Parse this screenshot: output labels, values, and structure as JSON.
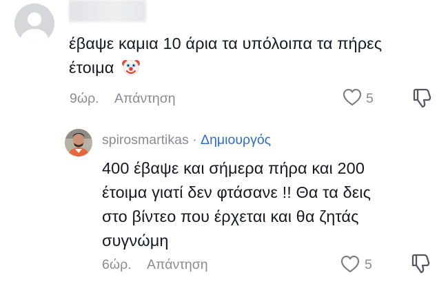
{
  "comment1": {
    "text_line1": "έβαψε καμια 10 άρια τα υπόλοιπα τα πήρες",
    "text_line2": "έτοιμα",
    "emoji": "clown-face-emoji",
    "time": "9ώρ.",
    "reply_label": "Απάντηση",
    "likes": "5"
  },
  "comment2": {
    "username": "spirosmartikas",
    "separator": "·",
    "badge": "Δημιουργός",
    "text_lines": [
      "400 έβαψε και σήμερα πήρα και 200",
      "έτοιμα γιατί δεν φτάσανε !! Θα τα δεις",
      "στο βίντεο που έρχεται και θα ζητάς",
      "συγνώμη"
    ],
    "time": "6ώρ.",
    "reply_label": "Απάντηση",
    "likes": "5"
  },
  "colors": {
    "text": "#161823",
    "muted": "#8a8b91",
    "creator_badge": "#2b6dd3"
  }
}
